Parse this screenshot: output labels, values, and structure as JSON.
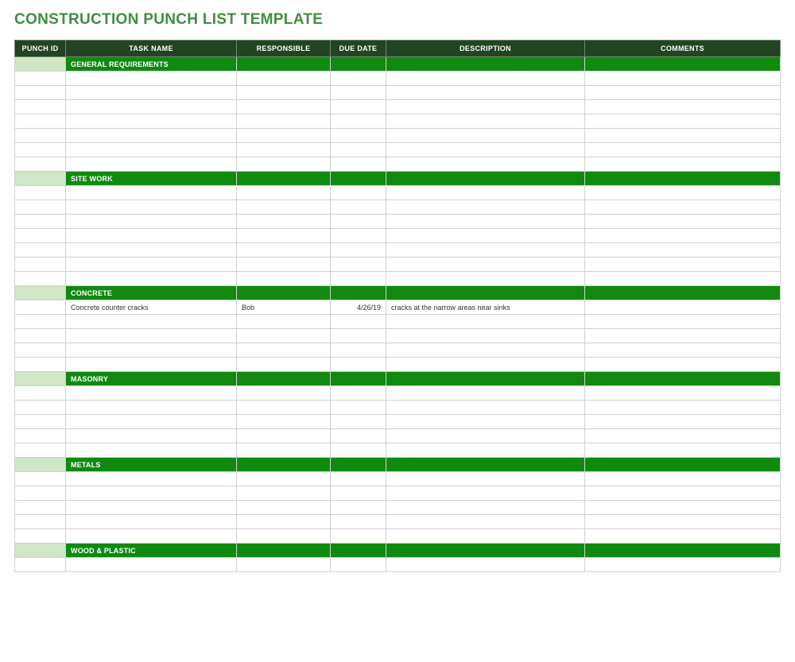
{
  "title": "CONSTRUCTION PUNCH LIST TEMPLATE",
  "columns": [
    "PUNCH ID",
    "TASK NAME",
    "RESPONSIBLE",
    "DUE DATE",
    "DESCRIPTION",
    "COMMENTS"
  ],
  "sections": [
    {
      "name": "GENERAL REQUIREMENTS",
      "rows": [
        {
          "punch_id": "",
          "task": "",
          "responsible": "",
          "due": "",
          "desc": "",
          "comments": ""
        },
        {
          "punch_id": "",
          "task": "",
          "responsible": "",
          "due": "",
          "desc": "",
          "comments": ""
        },
        {
          "punch_id": "",
          "task": "",
          "responsible": "",
          "due": "",
          "desc": "",
          "comments": ""
        },
        {
          "punch_id": "",
          "task": "",
          "responsible": "",
          "due": "",
          "desc": "",
          "comments": ""
        },
        {
          "punch_id": "",
          "task": "",
          "responsible": "",
          "due": "",
          "desc": "",
          "comments": ""
        },
        {
          "punch_id": "",
          "task": "",
          "responsible": "",
          "due": "",
          "desc": "",
          "comments": ""
        },
        {
          "punch_id": "",
          "task": "",
          "responsible": "",
          "due": "",
          "desc": "",
          "comments": ""
        }
      ]
    },
    {
      "name": "SITE WORK",
      "rows": [
        {
          "punch_id": "",
          "task": "",
          "responsible": "",
          "due": "",
          "desc": "",
          "comments": ""
        },
        {
          "punch_id": "",
          "task": "",
          "responsible": "",
          "due": "",
          "desc": "",
          "comments": ""
        },
        {
          "punch_id": "",
          "task": "",
          "responsible": "",
          "due": "",
          "desc": "",
          "comments": ""
        },
        {
          "punch_id": "",
          "task": "",
          "responsible": "",
          "due": "",
          "desc": "",
          "comments": ""
        },
        {
          "punch_id": "",
          "task": "",
          "responsible": "",
          "due": "",
          "desc": "",
          "comments": ""
        },
        {
          "punch_id": "",
          "task": "",
          "responsible": "",
          "due": "",
          "desc": "",
          "comments": ""
        },
        {
          "punch_id": "",
          "task": "",
          "responsible": "",
          "due": "",
          "desc": "",
          "comments": ""
        }
      ]
    },
    {
      "name": "CONCRETE",
      "rows": [
        {
          "punch_id": "",
          "task": "Concrete counter cracks",
          "responsible": "Bob",
          "due": "4/26/19",
          "desc": "cracks at the narrow areas near sinks",
          "comments": ""
        },
        {
          "punch_id": "",
          "task": "",
          "responsible": "",
          "due": "",
          "desc": "",
          "comments": ""
        },
        {
          "punch_id": "",
          "task": "",
          "responsible": "",
          "due": "",
          "desc": "",
          "comments": ""
        },
        {
          "punch_id": "",
          "task": "",
          "responsible": "",
          "due": "",
          "desc": "",
          "comments": ""
        },
        {
          "punch_id": "",
          "task": "",
          "responsible": "",
          "due": "",
          "desc": "",
          "comments": ""
        }
      ]
    },
    {
      "name": "MASONRY",
      "rows": [
        {
          "punch_id": "",
          "task": "",
          "responsible": "",
          "due": "",
          "desc": "",
          "comments": ""
        },
        {
          "punch_id": "",
          "task": "",
          "responsible": "",
          "due": "",
          "desc": "",
          "comments": ""
        },
        {
          "punch_id": "",
          "task": "",
          "responsible": "",
          "due": "",
          "desc": "",
          "comments": ""
        },
        {
          "punch_id": "",
          "task": "",
          "responsible": "",
          "due": "",
          "desc": "",
          "comments": ""
        },
        {
          "punch_id": "",
          "task": "",
          "responsible": "",
          "due": "",
          "desc": "",
          "comments": ""
        }
      ]
    },
    {
      "name": "METALS",
      "rows": [
        {
          "punch_id": "",
          "task": "",
          "responsible": "",
          "due": "",
          "desc": "",
          "comments": ""
        },
        {
          "punch_id": "",
          "task": "",
          "responsible": "",
          "due": "",
          "desc": "",
          "comments": ""
        },
        {
          "punch_id": "",
          "task": "",
          "responsible": "",
          "due": "",
          "desc": "",
          "comments": ""
        },
        {
          "punch_id": "",
          "task": "",
          "responsible": "",
          "due": "",
          "desc": "",
          "comments": ""
        },
        {
          "punch_id": "",
          "task": "",
          "responsible": "",
          "due": "",
          "desc": "",
          "comments": ""
        }
      ]
    },
    {
      "name": "WOOD & PLASTIC",
      "rows": [
        {
          "punch_id": "",
          "task": "",
          "responsible": "",
          "due": "",
          "desc": "",
          "comments": ""
        }
      ]
    }
  ]
}
